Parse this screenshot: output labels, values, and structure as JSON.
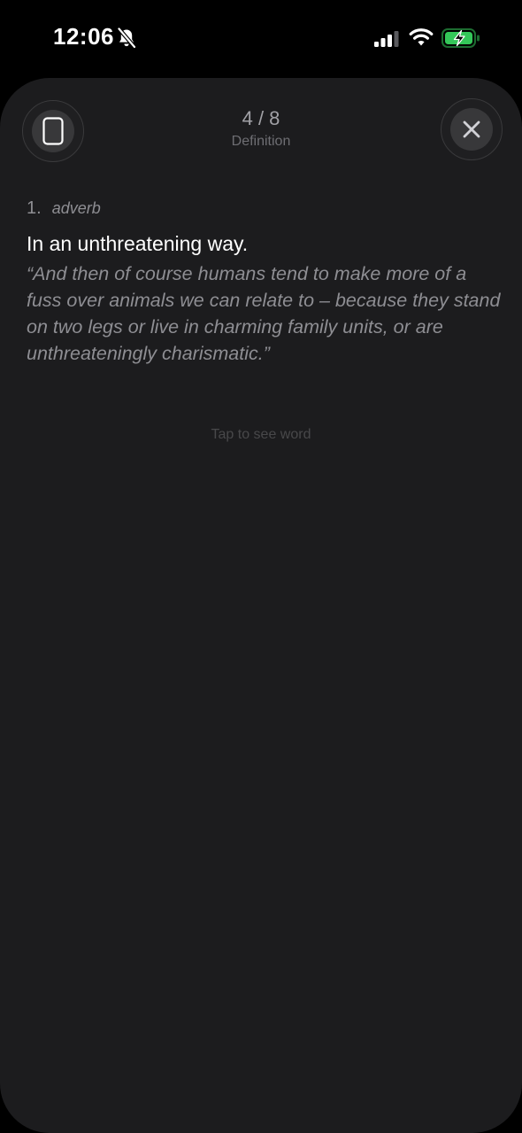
{
  "status_bar": {
    "time": "12:06",
    "icons": [
      "bell-slash-icon",
      "cellular-signal-icon",
      "wifi-icon",
      "battery-charging-icon"
    ],
    "battery_color": "#34c759"
  },
  "header": {
    "left_button_icon": "card-icon",
    "progress": "4 / 8",
    "mode": "Definition",
    "right_button_icon": "close-icon"
  },
  "definition": {
    "number": "1.",
    "part_of_speech": "adverb",
    "text": "In an unthreatening way.",
    "example": "“And then of course humans tend to make more of a fuss over animals we can relate to – because they stand on two legs or live in charming family units, or are unthreateningly charismatic.”"
  },
  "hint": "Tap to see word",
  "colors": {
    "background": "#000000",
    "sheet": "#1c1c1e",
    "primary_text": "#ffffff",
    "secondary_text": "#8e8e93"
  }
}
